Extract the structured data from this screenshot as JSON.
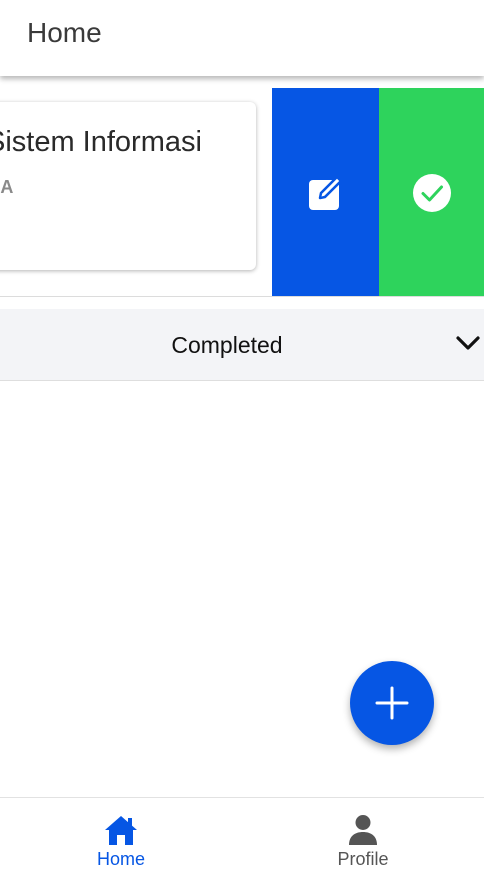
{
  "header": {
    "title": "Home"
  },
  "task_item": {
    "title": "Sistem Informasi",
    "subtitle": "s A",
    "actions": [
      {
        "name": "edit",
        "icon": "edit-square-icon",
        "color": "#0656e4"
      },
      {
        "name": "complete",
        "icon": "check-circle-icon",
        "color": "#2ed35c"
      }
    ]
  },
  "completed_section": {
    "label": "Completed",
    "icon": "chevron-down-icon",
    "expanded": false
  },
  "fab": {
    "icon": "plus-icon",
    "color": "#0656e4"
  },
  "bottom_nav": {
    "items": [
      {
        "label": "Home",
        "icon": "home-icon",
        "active": true
      },
      {
        "label": "Profile",
        "icon": "person-icon",
        "active": false
      }
    ]
  },
  "colors": {
    "accent": "#0656e4",
    "success": "#2ed35c",
    "section_bg": "#f3f4f7"
  }
}
